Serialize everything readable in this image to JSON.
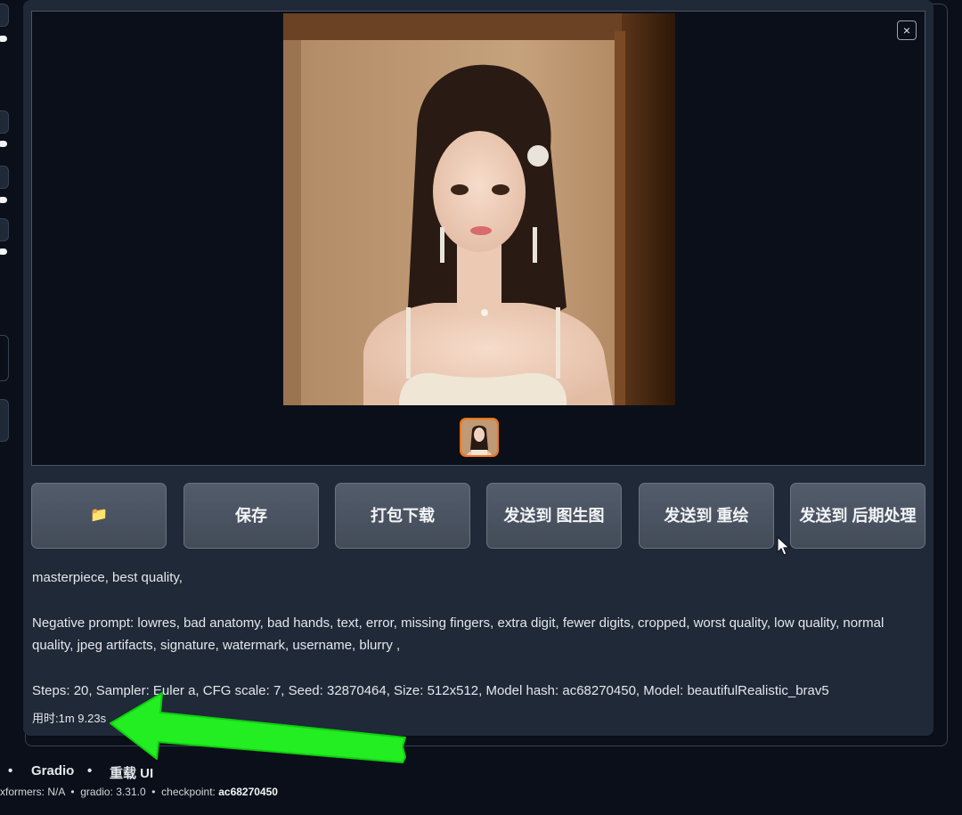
{
  "gallery": {
    "close_label": "×"
  },
  "buttons": [
    {
      "id": "open-folder",
      "label": "📁"
    },
    {
      "id": "save",
      "label": "保存"
    },
    {
      "id": "zip-download",
      "label": "打包下载"
    },
    {
      "id": "send-img2img",
      "label": "发送到 图生图"
    },
    {
      "id": "send-inpaint",
      "label": "发送到 重绘"
    },
    {
      "id": "send-extras",
      "label": "发送到 后期处理"
    }
  ],
  "generation_info": {
    "prompt": "masterpiece, best quality,",
    "negative_line1": "Negative prompt: lowres, bad anatomy, bad hands, text, error, missing fingers, extra digit, fewer digits, cropped, worst quality, low quality, normal",
    "negative_line2": "quality, jpeg artifacts, signature, watermark, username, blurry ,",
    "parameters": "Steps: 20, Sampler: Euler a, CFG scale: 7, Seed: 32870464, Size: 512x512, Model hash: ac68270450, Model: beautifulRealistic_brav5",
    "time_taken": "用时:1m 9.23s"
  },
  "footer": {
    "bullet": "•",
    "gradio_link": "Gradio",
    "reload_link": "重载 UI",
    "xformers": "xformers: N/A",
    "gradio_label": "gradio: 3.31.0",
    "checkpoint_label": "checkpoint:",
    "checkpoint_value": "ac68270450"
  },
  "colors": {
    "background": "#0b0f19",
    "panel": "#1f2937",
    "button": "#4b5563",
    "thumb_border": "#f97316",
    "arrow": "#22ee22"
  },
  "icons": [
    "close-icon",
    "folder-icon",
    "cursor-icon",
    "green-arrow-annotation"
  ]
}
